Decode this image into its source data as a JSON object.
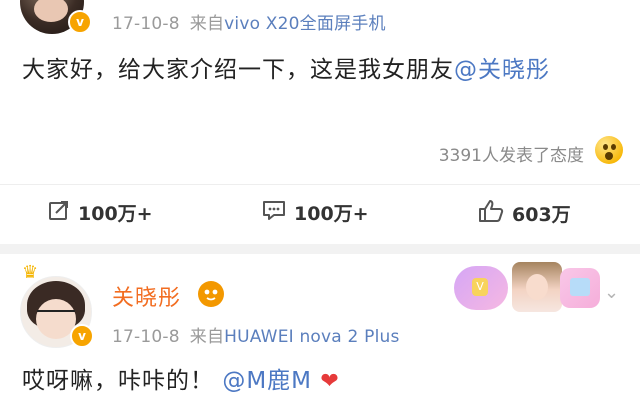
{
  "post1": {
    "date": "17-10-8",
    "source_prefix": "来自",
    "device": "vivo X20全面屏手机",
    "text": "大家好，给大家介绍一下，这是我女朋友",
    "mention": "@关晓彤",
    "reactions_text": "3391人发表了态度",
    "actions": {
      "share_count": "100万+",
      "comment_count": "100万+",
      "like_count": "603万"
    }
  },
  "post2": {
    "username": "关晓彤",
    "date": "17-10-8",
    "source_prefix": "来自",
    "device": "HUAWEI nova 2 Plus",
    "text": "哎呀嘛，咔咔的！",
    "mention": "@M鹿M",
    "heart": "❤"
  },
  "icons": {
    "verified": "v",
    "share": "share-icon",
    "comment": "comment-icon",
    "like": "thumbs-up-icon",
    "crown": "♛",
    "chevron": "⌄"
  },
  "colors": {
    "username": "#f26d21",
    "mention": "#4c78c3",
    "verified_badge": "#f7a400",
    "heart": "#e63a3a"
  }
}
